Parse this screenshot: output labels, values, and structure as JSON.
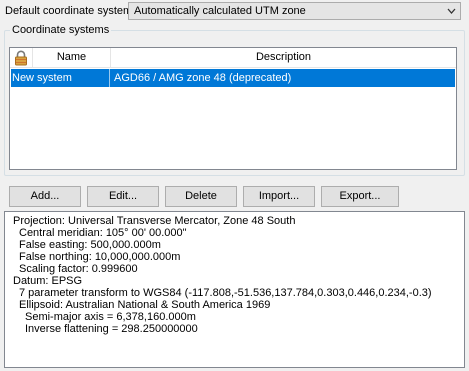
{
  "top": {
    "label": "Default coordinate system",
    "combo_value": "Automatically calculated UTM zone"
  },
  "group": {
    "title": "Coordinate systems"
  },
  "table": {
    "headers": {
      "name": "Name",
      "description": "Description"
    },
    "rows": [
      {
        "name": "New system",
        "description": "AGD66 / AMG zone 48 (deprecated)",
        "selected": true
      }
    ]
  },
  "buttons": {
    "add": "Add...",
    "edit": "Edit...",
    "delete": "Delete",
    "import": "Import...",
    "export": "Export..."
  },
  "details": {
    "lines": [
      "Projection: Universal Transverse Mercator, Zone 48 South",
      "Central meridian: 105° 00' 00.000\"",
      "False easting: 500,000.000m",
      "False northing: 10,000,000.000m",
      "Scaling factor: 0.999600",
      "Datum: EPSG",
      "7 parameter transform to WGS84 (-117.808,-51.536,137.784,0.303,0.446,0.234,-0.3)",
      "Ellipsoid: Australian National & South America 1969",
      "Semi-major axis = 6,378,160.000m",
      "Inverse flattening = 298.250000000"
    ]
  },
  "colors": {
    "selection": "#0078d7",
    "lock": "#c8a04a"
  },
  "icons": {
    "header": "lock-icon",
    "combo": "chevron-down-icon"
  }
}
